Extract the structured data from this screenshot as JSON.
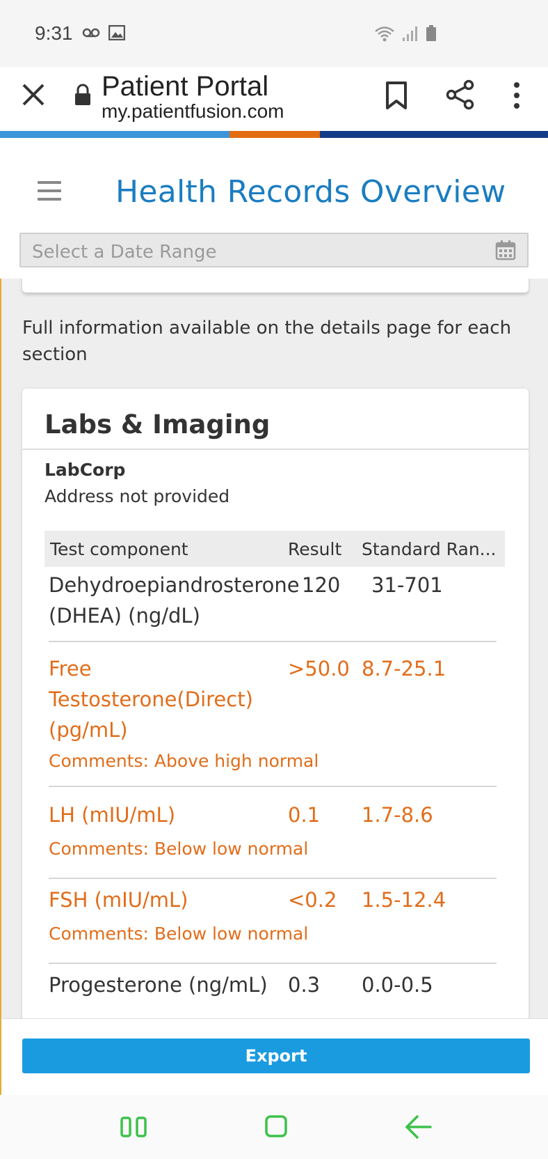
{
  "status_bar": {
    "time": "9:31",
    "left_icons": [
      "voicemail-icon",
      "image-icon"
    ],
    "right_icons": [
      "wifi-icon",
      "signal-icon",
      "battery-icon"
    ]
  },
  "browser": {
    "title": "Patient Portal",
    "url": "my.patientfusion.com",
    "icons": [
      "close-icon",
      "lock-icon",
      "bookmark-icon",
      "share-icon",
      "more-vert-icon"
    ],
    "brand_colors": [
      "#3b95d9",
      "#e36c12",
      "#123c87"
    ]
  },
  "header": {
    "title": "Health Records Overview",
    "date_range_placeholder": "Select a Date Range"
  },
  "content": {
    "info_text": "Full information available on the details page for each section",
    "labs_card": {
      "title": "Labs & Imaging",
      "lab_name": "LabCorp",
      "lab_address": "Address not provided",
      "columns": [
        "Test component",
        "Result",
        "Standard Ran..."
      ],
      "rows": [
        {
          "component": "Dehydroepiandrosterone (DHEA) (ng/dL)",
          "result": "120",
          "range": "31-701",
          "comment": "",
          "abnormal": false
        },
        {
          "component": "Free Testosterone(Direct) (pg/mL)",
          "result": ">50.0",
          "range": "8.7-25.1",
          "comment": "Comments: Above high normal",
          "abnormal": true
        },
        {
          "component": "LH (mIU/mL)",
          "result": "0.1",
          "range": "1.7-8.6",
          "comment": "Comments: Below low normal",
          "abnormal": true
        },
        {
          "component": "FSH (mIU/mL)",
          "result": "<0.2",
          "range": "1.5-12.4",
          "comment": "Comments: Below low normal",
          "abnormal": true
        },
        {
          "component": "Progesterone (ng/mL)",
          "result": "0.3",
          "range": "0.0-0.5",
          "comment": "",
          "abnormal": false
        }
      ]
    }
  },
  "footer": {
    "export_label": "Export"
  },
  "colors": {
    "accent": "#1b7dc1",
    "abnormal": "#e16d1a",
    "export_button": "#1a9be0",
    "nav_icons": "#3cc24a"
  },
  "nav_bar": {
    "icons": [
      "recent-apps-icon",
      "home-icon",
      "back-icon"
    ]
  }
}
